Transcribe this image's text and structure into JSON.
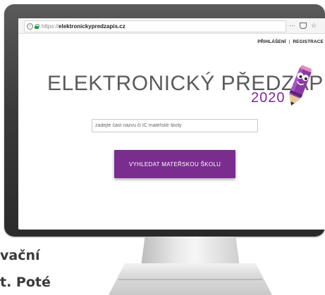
{
  "browser": {
    "url_protocol": "https://",
    "url_host": "elektronickypredzapis.cz",
    "menu_icon": "ellipsis-icon",
    "pocket_icon": "pocket-icon",
    "bookmark_icon": "star-icon"
  },
  "header": {
    "login_label": "PŘIHLÁŠENÍ",
    "separator": "|",
    "register_label": "REGISTRACE"
  },
  "logo": {
    "title": "ELEKTRONICKÝ PŘEDZÁPIS",
    "year": "2020",
    "title_color": "#5b5b5b",
    "year_color": "#7b2b93"
  },
  "search": {
    "placeholder": "zadejte část názvu či IČ mateřské školy",
    "value": "",
    "button_label": "VYHLEDAT MATEŘSKOU ŠKOLU",
    "button_color": "#7a2d8f"
  },
  "background_text": {
    "line1": "vační",
    "line2": "t. Poté"
  }
}
